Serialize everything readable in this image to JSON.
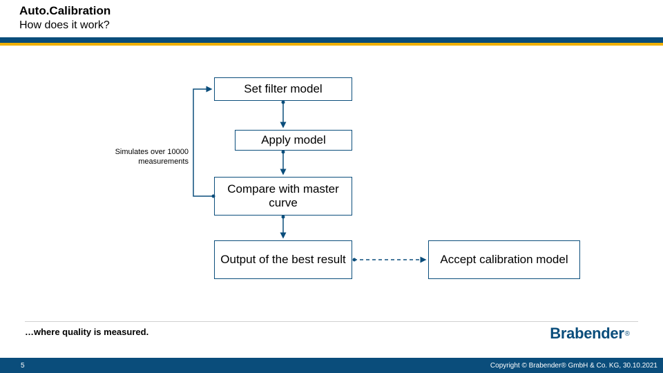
{
  "header": {
    "title": "Auto.Calibration",
    "subtitle": "How does it work?"
  },
  "side_label": "Simulates over 10000 measurements",
  "boxes": {
    "b1": "Set filter model",
    "b2": "Apply model",
    "b3": "Compare with master curve",
    "b4": "Output of the best result",
    "b5": "Accept calibration model"
  },
  "tagline": "…where quality is measured.",
  "logo": "Brabender",
  "footer": {
    "page": "5",
    "copyright": "Copyright © Brabender® GmbH & Co. KG, 30.10.2021"
  },
  "colors": {
    "brand": "#0a4d7b",
    "accent": "#f0b000"
  }
}
